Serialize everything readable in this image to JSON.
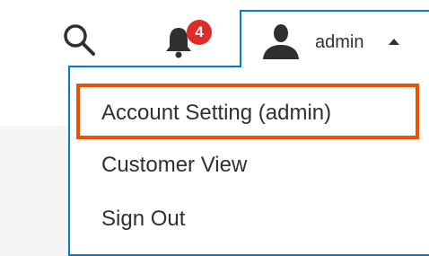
{
  "header": {
    "search_icon": "search-icon",
    "notifications": {
      "icon": "bell-icon",
      "count": "4",
      "badge_color": "#e02b27"
    },
    "user": {
      "icon": "user-icon",
      "name": "admin",
      "caret_icon": "caret-up-icon"
    }
  },
  "dropdown": {
    "border_color": "#007bdb",
    "highlight_color": "#eb5202",
    "items": [
      {
        "label": "Account Setting (admin)",
        "highlighted": true
      },
      {
        "label": "Customer View"
      },
      {
        "label": "Sign Out"
      }
    ]
  }
}
